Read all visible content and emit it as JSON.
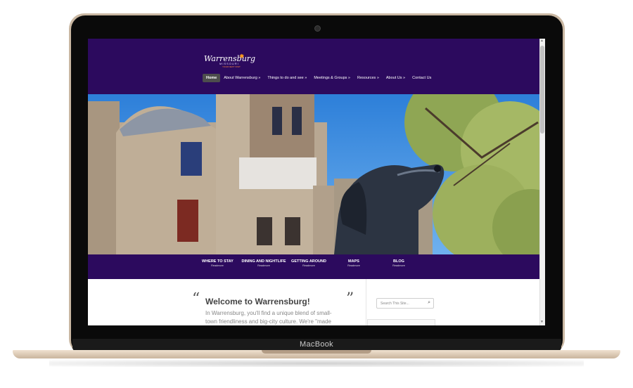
{
  "device": {
    "brand": "MacBook"
  },
  "site": {
    "logo": {
      "script": "Warrensburg",
      "sub": "MISSOURI",
      "tag": "YOUR NEXT VISIT"
    },
    "nav": [
      {
        "label": "Home",
        "active": true
      },
      {
        "label": "About Warrensburg »"
      },
      {
        "label": "Things to do and see »"
      },
      {
        "label": "Meetings & Groups »"
      },
      {
        "label": "Resources »"
      },
      {
        "label": "About Us »"
      },
      {
        "label": "Contact Us"
      }
    ],
    "quick_links": [
      {
        "title": "WHERE TO STAY",
        "more": "Readmore"
      },
      {
        "title": "DINING AND NIGHTLIFE",
        "more": "Readmore"
      },
      {
        "title": "GETTING AROUND",
        "more": "Readmore"
      },
      {
        "title": "MAPS",
        "more": "Readmore"
      },
      {
        "title": "BLOG",
        "more": "Readmore"
      }
    ],
    "welcome": {
      "heading": "Welcome to Warrensburg!",
      "text": "In Warrensburg, you'll find a unique blend of small-town friendliness and big-city culture. We're \"made"
    },
    "search": {
      "placeholder": "Search This Site..."
    },
    "colors": {
      "primary": "#2c0a5e",
      "active_nav": "#4d4d4d"
    }
  }
}
